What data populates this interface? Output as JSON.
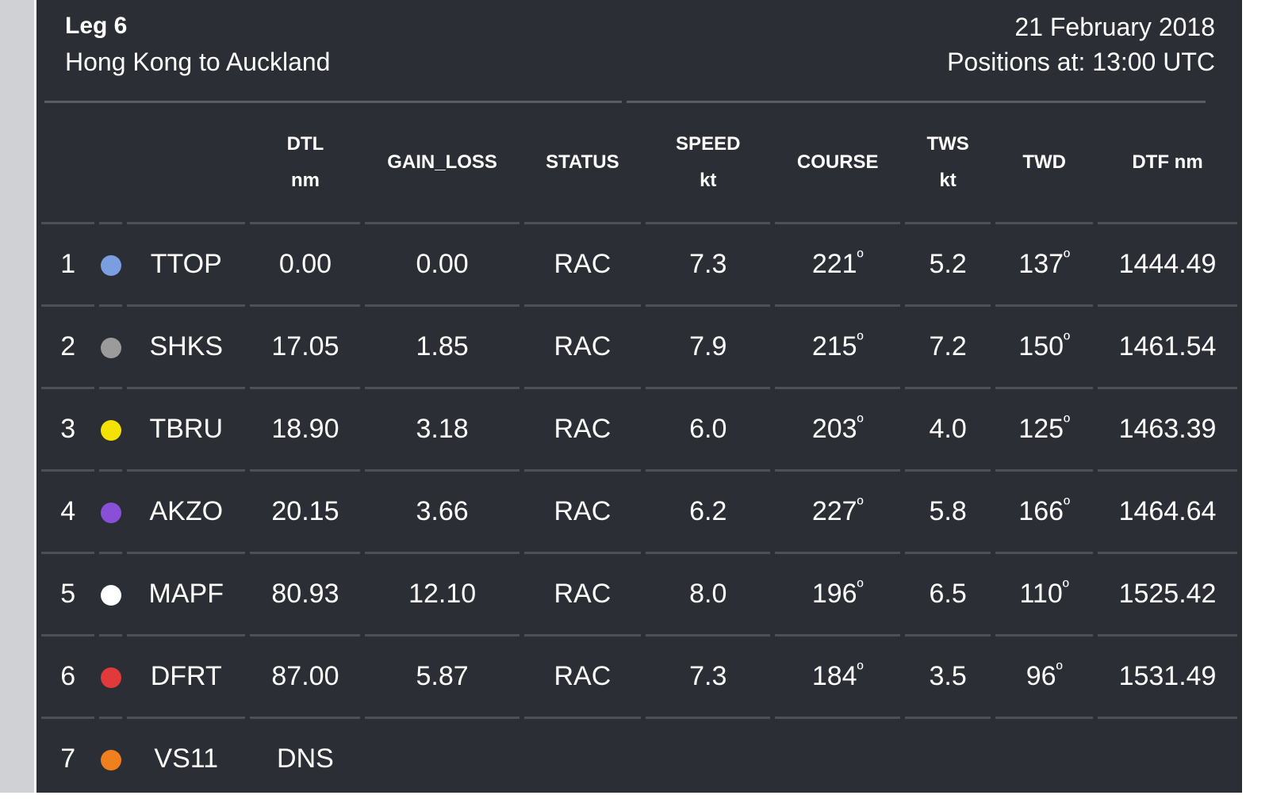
{
  "header": {
    "leg": "Leg 6",
    "route": "Hong Kong to Auckland",
    "date": "21 February 2018",
    "positions_at": "Positions at: 13:00 UTC"
  },
  "columns": [
    {
      "key": "rank",
      "line1": "",
      "line2": ""
    },
    {
      "key": "color",
      "line1": "",
      "line2": ""
    },
    {
      "key": "team",
      "line1": "",
      "line2": ""
    },
    {
      "key": "dtl",
      "line1": "DTL",
      "line2": "nm"
    },
    {
      "key": "gain_loss",
      "line1": "GAIN_LOSS",
      "line2": ""
    },
    {
      "key": "status",
      "line1": "STATUS",
      "line2": ""
    },
    {
      "key": "speed",
      "line1": "SPEED",
      "line2": "kt"
    },
    {
      "key": "course",
      "line1": "COURSE",
      "line2": ""
    },
    {
      "key": "tws",
      "line1": "TWS",
      "line2": "kt"
    },
    {
      "key": "twd",
      "line1": "TWD",
      "line2": ""
    },
    {
      "key": "dtf",
      "line1": "DTF nm",
      "line2": ""
    }
  ],
  "rows": [
    {
      "rank": "1",
      "color": "#7b9ee0",
      "team": "TTOP",
      "dtl": "0.00",
      "gain_loss": "0.00",
      "status": "RAC",
      "speed": "7.3",
      "course": "221",
      "tws": "5.2",
      "twd": "137",
      "dtf": "1444.49"
    },
    {
      "rank": "2",
      "color": "#9b9b9b",
      "team": "SHKS",
      "dtl": "17.05",
      "gain_loss": "1.85",
      "status": "RAC",
      "speed": "7.9",
      "course": "215",
      "tws": "7.2",
      "twd": "150",
      "dtf": "1461.54"
    },
    {
      "rank": "3",
      "color": "#f4e300",
      "team": "TBRU",
      "dtl": "18.90",
      "gain_loss": "3.18",
      "status": "RAC",
      "speed": "6.0",
      "course": "203",
      "tws": "4.0",
      "twd": "125",
      "dtf": "1463.39"
    },
    {
      "rank": "4",
      "color": "#8a4fd8",
      "team": "AKZO",
      "dtl": "20.15",
      "gain_loss": "3.66",
      "status": "RAC",
      "speed": "6.2",
      "course": "227",
      "tws": "5.8",
      "twd": "166",
      "dtf": "1464.64"
    },
    {
      "rank": "5",
      "color": "#ffffff",
      "team": "MAPF",
      "dtl": "80.93",
      "gain_loss": "12.10",
      "status": "RAC",
      "speed": "8.0",
      "course": "196",
      "tws": "6.5",
      "twd": "110",
      "dtf": "1525.42"
    },
    {
      "rank": "6",
      "color": "#e03a3a",
      "team": "DFRT",
      "dtl": "87.00",
      "gain_loss": "5.87",
      "status": "RAC",
      "speed": "7.3",
      "course": "184",
      "tws": "3.5",
      "twd": "96",
      "dtf": "1531.49"
    },
    {
      "rank": "7",
      "color": "#f07f1e",
      "team": "VS11",
      "dtl": "DNS",
      "gain_loss": "",
      "status": "",
      "speed": "",
      "course": "",
      "tws": "",
      "twd": "",
      "dtf": ""
    }
  ],
  "degree_symbol": "º"
}
